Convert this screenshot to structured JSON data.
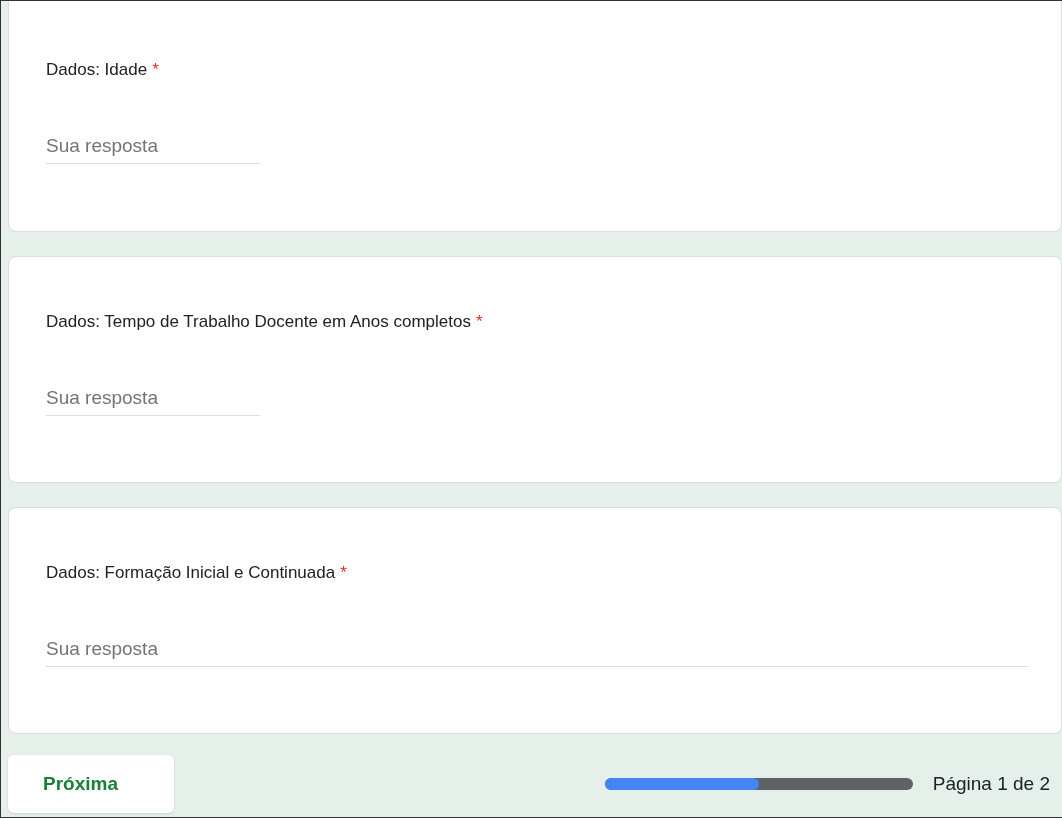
{
  "questions": [
    {
      "title": "Dados: Idade",
      "required_mark": "*",
      "kind": "short",
      "placeholder": "Sua resposta"
    },
    {
      "title": "Dados: Tempo de Trabalho Docente em Anos completos",
      "required_mark": "*",
      "kind": "short",
      "placeholder": "Sua resposta"
    },
    {
      "title": "Dados: Formação Inicial e Continuada",
      "required_mark": "*",
      "kind": "wide",
      "placeholder": "Sua resposta"
    }
  ],
  "next_button": "Próxima",
  "progress": {
    "level": 0.5,
    "label": "Página 1 de 2"
  }
}
